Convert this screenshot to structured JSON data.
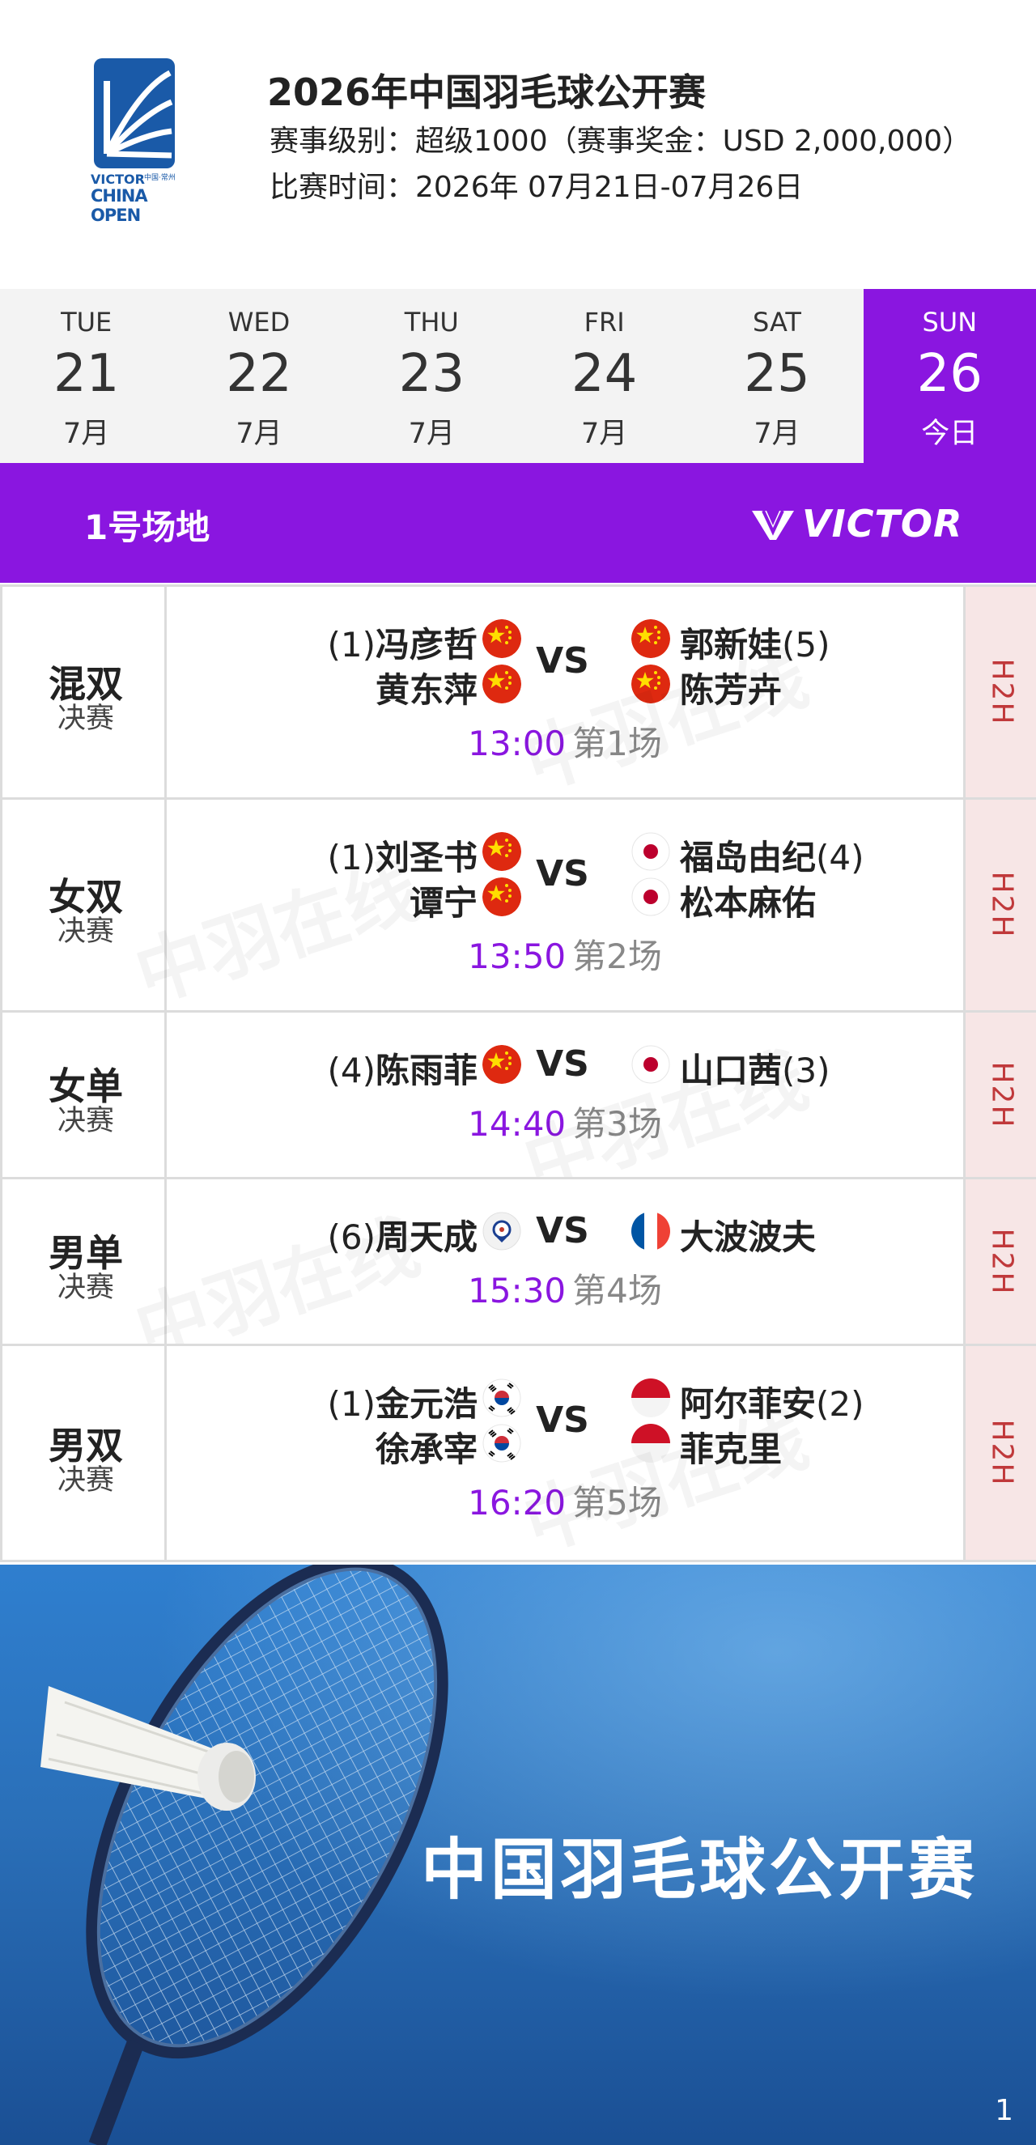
{
  "header": {
    "title": "2026年中国羽毛球公开赛",
    "level_line": "赛事级别：超级1000（赛事奖金：USD 2,000,000）",
    "date_line": "比赛时间：2026年 07月21日-07月26日",
    "logo_text_1": "VICTOR",
    "logo_text_2": "CHINA OPEN",
    "logo_sub": "中国·常州"
  },
  "dates": [
    {
      "dow": "TUE",
      "day": "21",
      "month": "7月"
    },
    {
      "dow": "WED",
      "day": "22",
      "month": "7月"
    },
    {
      "dow": "THU",
      "day": "23",
      "month": "7月"
    },
    {
      "dow": "FRI",
      "day": "24",
      "month": "7月"
    },
    {
      "dow": "SAT",
      "day": "25",
      "month": "7月"
    },
    {
      "dow": "SUN",
      "day": "26",
      "month": "今日"
    }
  ],
  "court": {
    "name": "1号场地",
    "sponsor": "VICTOR"
  },
  "vs_label": "VS",
  "h2h_label": "H2H",
  "matches": [
    {
      "event": "混双",
      "stage": "决赛",
      "left": [
        {
          "seed": "(1)",
          "name": "冯彦哲",
          "flag": "china"
        },
        {
          "seed": "",
          "name": "黄东萍",
          "flag": "china"
        }
      ],
      "right": [
        {
          "seed": "(5)",
          "name": "郭新娃",
          "flag": "china"
        },
        {
          "seed": "",
          "name": "陈芳卉",
          "flag": "china"
        }
      ],
      "time": "13:00",
      "order": "第1场"
    },
    {
      "event": "女双",
      "stage": "决赛",
      "left": [
        {
          "seed": "(1)",
          "name": "刘圣书",
          "flag": "china"
        },
        {
          "seed": "",
          "name": "谭宁",
          "flag": "china"
        }
      ],
      "right": [
        {
          "seed": "(4)",
          "name": "福岛由纪",
          "flag": "japan"
        },
        {
          "seed": "",
          "name": "松本麻佑",
          "flag": "japan"
        }
      ],
      "time": "13:50",
      "order": "第2场"
    },
    {
      "event": "女单",
      "stage": "决赛",
      "left": [
        {
          "seed": "(4)",
          "name": "陈雨菲",
          "flag": "china"
        }
      ],
      "right": [
        {
          "seed": "(3)",
          "name": "山口茜",
          "flag": "japan"
        }
      ],
      "time": "14:40",
      "order": "第3场"
    },
    {
      "event": "男单",
      "stage": "决赛",
      "left": [
        {
          "seed": "(6)",
          "name": "周天成",
          "flag": "chinese-taipei"
        }
      ],
      "right": [
        {
          "seed": "",
          "name": "大波波夫",
          "flag": "france"
        }
      ],
      "time": "15:30",
      "order": "第4场"
    },
    {
      "event": "男双",
      "stage": "决赛",
      "left": [
        {
          "seed": "(1)",
          "name": "金元浩",
          "flag": "korea"
        },
        {
          "seed": "",
          "name": "徐承宰",
          "flag": "korea"
        }
      ],
      "right": [
        {
          "seed": "(2)",
          "name": "阿尔菲安",
          "flag": "indonesia"
        },
        {
          "seed": "",
          "name": "菲克里",
          "flag": "indonesia"
        }
      ],
      "time": "16:20",
      "order": "第5场"
    }
  ],
  "watermark": "中羽在线",
  "banner": {
    "title": "中国羽毛球公开赛",
    "page_number": "1"
  },
  "colors": {
    "accent": "#8a16e0",
    "h2h_bg": "#f7e6e6",
    "h2h_text": "#c0393b",
    "order_gray": "#888888"
  }
}
